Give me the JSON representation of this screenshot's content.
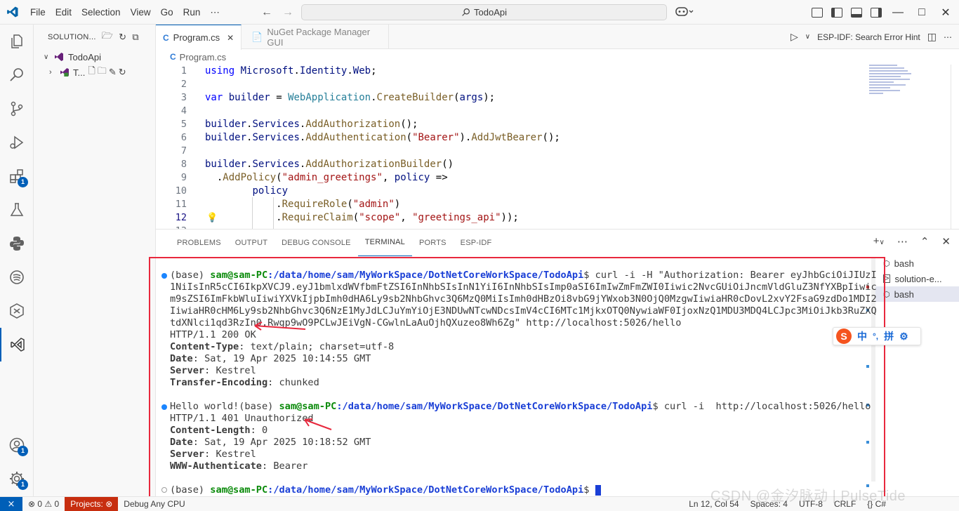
{
  "menu": [
    "File",
    "Edit",
    "Selection",
    "View",
    "Go",
    "Run",
    "⋯"
  ],
  "command_center": "TodoApi",
  "sidebar": {
    "title": "SOLUTION...",
    "items": [
      {
        "label": "TodoApi"
      },
      {
        "label": "T..."
      }
    ]
  },
  "tabs": [
    {
      "label": "Program.cs",
      "active": true
    },
    {
      "label": "NuGet Package Manager GUI",
      "active": false
    }
  ],
  "tab_actions": {
    "run_label": "ESP-IDF: Search Error Hint"
  },
  "breadcrumb": "Program.cs",
  "code": {
    "current_line": 12,
    "lines": [
      {
        "n": "1",
        "text": "using Microsoft.Identity.Web;"
      },
      {
        "n": "2",
        "text": ""
      },
      {
        "n": "3",
        "text": "var builder = WebApplication.CreateBuilder(args);"
      },
      {
        "n": "4",
        "text": ""
      },
      {
        "n": "5",
        "text": "builder.Services.AddAuthorization();"
      },
      {
        "n": "6",
        "text": "builder.Services.AddAuthentication(\"Bearer\").AddJwtBearer();"
      },
      {
        "n": "7",
        "text": ""
      },
      {
        "n": "8",
        "text": "builder.Services.AddAuthorizationBuilder()"
      },
      {
        "n": "9",
        "text": "  .AddPolicy(\"admin_greetings\", policy =>"
      },
      {
        "n": "10",
        "text": "        policy"
      },
      {
        "n": "11",
        "text": "            .RequireRole(\"admin\")"
      },
      {
        "n": "12",
        "text": "            .RequireClaim(\"scope\", \"greetings_api\"));"
      },
      {
        "n": "13",
        "text": ""
      }
    ]
  },
  "panel": {
    "tabs": [
      "PROBLEMS",
      "OUTPUT",
      "DEBUG CONSOLE",
      "TERMINAL",
      "PORTS",
      "ESP-IDF"
    ],
    "active_tab": "TERMINAL",
    "terminals": [
      "bash",
      "solution-e...",
      "bash"
    ]
  },
  "terminal": {
    "prompt_env": "(base) ",
    "user_host": "sam@sam-PC",
    "path": ":/data/home/sam/MyWorkSpace/DotNetCoreWorkSpace/TodoApi",
    "cmd1": "$ curl -i -H \"Authorization: Bearer eyJhbGciOiJIUzI",
    "cmd1_wrap": [
      "1NiIsInR5cCI6IkpXVCJ9.eyJ1bmlxdWVfbmFtZSI6InNhbSIsInN1YiI6InNhbSIsImp0aSI6ImIwZmFmZWI0Iiwic2NvcGUiOiJncmVldGluZ3NfYXBpIiwic",
      "m9sZSI6ImFkbWluIiwiYXVkIjpbImh0dHA6Ly9sb2NhbGhvc3Q6MzQ0MiIsImh0dHBzOi8vbG9jYWxob3N0OjQ0MzgwIiwiaHR0cDovL2xvY2FsaG9zdDo1MDI2",
      "IiwiaHR0cHM6Ly9sb2NhbGhvc3Q6NzE1MyJdLCJuYmYiOjE3NDUwNTcwNDcsImV4cCI6MTc1MjkxOTQ0NywiaWF0IjoxNzQ1MDU3MDQ4LCJpc3MiOiJkb3RuZXQ",
      "tdXNlci1qd3RzIn0.Rwgp9wO9PCLwJEiVgN-CGwlnLaAuOjhQXuzeo8Wh6Zg\" http://localhost:5026/hello"
    ],
    "resp1": [
      {
        "key": "",
        "val": "HTTP/1.1 200 OK"
      },
      {
        "key": "Content-Type",
        "val": ": text/plain; charset=utf-8"
      },
      {
        "key": "Date",
        "val": ": Sat, 19 Apr 2025 10:14:55 GMT"
      },
      {
        "key": "Server",
        "val": ": Kestrel"
      },
      {
        "key": "Transfer-Encoding",
        "val": ": chunked"
      }
    ],
    "line2_prefix": "Hello world!(base) ",
    "cmd2": "$ curl -i  http://localhost:5026/hello",
    "resp2": [
      {
        "key": "",
        "val": "HTTP/1.1 401 Unauthorized"
      },
      {
        "key": "Content-Length",
        "val": ": 0"
      },
      {
        "key": "Date",
        "val": ": Sat, 19 Apr 2025 10:18:52 GMT"
      },
      {
        "key": "Server",
        "val": ": Kestrel"
      },
      {
        "key": "WWW-Authenticate",
        "val": ": Bearer"
      }
    ],
    "cmd3": "$ "
  },
  "ime": {
    "mode": "中",
    "punct": "°,",
    "pinyin": "拼"
  },
  "statusbar": {
    "problems": "0",
    "warnings": "0",
    "projects": "Projects:",
    "debug": "Debug Any CPU",
    "position": "Ln 12, Col 54",
    "spaces": "Spaces: 4",
    "encoding": "UTF-8",
    "eol": "CRLF",
    "language": "{} C#"
  },
  "watermark": "CSDN @金汐脉动 | PulseTide",
  "colors": {
    "accent": "#005fb8",
    "highlight_border": "#e8283d",
    "projects_bg": "#c72e0f"
  }
}
